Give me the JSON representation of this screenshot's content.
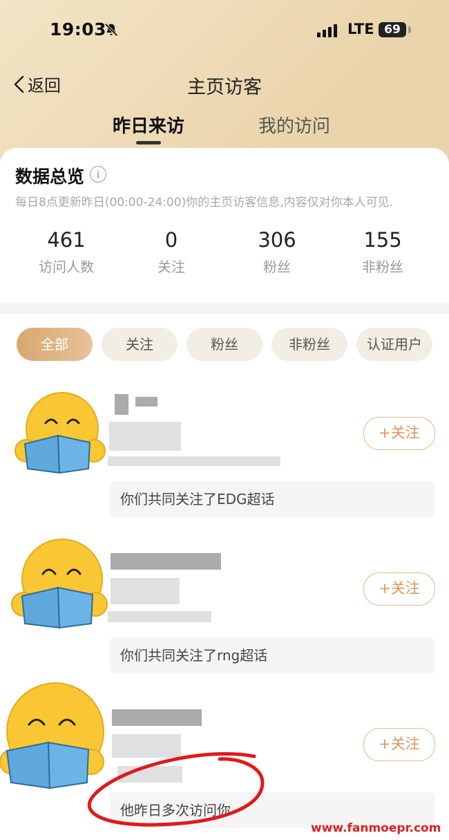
{
  "status_bar": {
    "time": "19:03",
    "network": "LTE",
    "battery": "69"
  },
  "nav": {
    "back_label": "返回",
    "title": "主页访客"
  },
  "tabs": [
    {
      "label": "昨日来访",
      "active": true
    },
    {
      "label": "我的访问",
      "active": false
    }
  ],
  "overview": {
    "title": "数据总览",
    "description": "每日8点更新昨日(00:00-24:00)你的主页访客信息,内容仅对你本人可见.",
    "stats": [
      {
        "value": "461",
        "label": "访问人数"
      },
      {
        "value": "0",
        "label": "关注"
      },
      {
        "value": "306",
        "label": "粉丝"
      },
      {
        "value": "155",
        "label": "非粉丝"
      }
    ]
  },
  "filters": [
    {
      "label": "全部",
      "active": true
    },
    {
      "label": "关注",
      "active": false
    },
    {
      "label": "粉丝",
      "active": false
    },
    {
      "label": "非粉丝",
      "active": false
    },
    {
      "label": "认证用户",
      "active": false
    }
  ],
  "visitors": [
    {
      "follow_label": "+关注",
      "reason": "你们共同关注了EDG超话"
    },
    {
      "follow_label": "+关注",
      "reason": "你们共同关注了rng超话"
    },
    {
      "follow_label": "+关注",
      "reason": "他昨日多次访问你"
    }
  ],
  "watermark": "www.fanmoepr.com",
  "colors": {
    "accent": "#e1965a",
    "header_gold": "#eedbb6",
    "annotation_red": "#e01a1a"
  }
}
